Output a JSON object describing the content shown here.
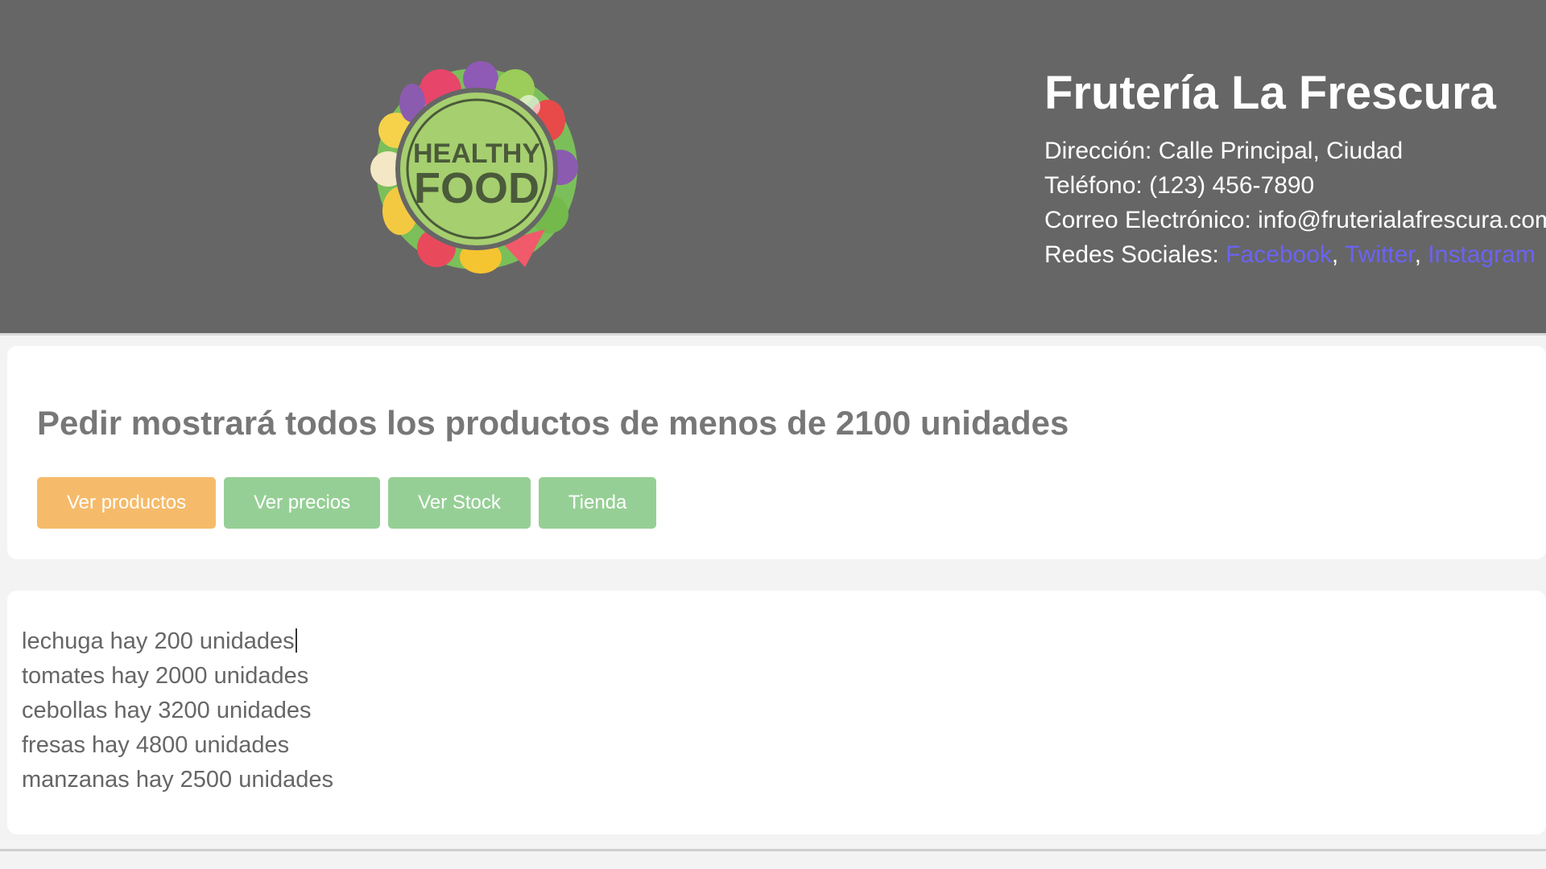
{
  "header": {
    "logo": {
      "line1": "HEALTHY",
      "line2": "FOOD",
      "ring_color": "#a6cf6f",
      "text_color": "#4a5a3a"
    },
    "title": "Frutería La Frescura",
    "address": "Dirección: Calle Principal, Ciudad",
    "phone": "Teléfono: (123) 456-7890",
    "email": "Correo Electrónico: info@fruterialafrescura.com",
    "social_label": "Redes Sociales:",
    "social_links": {
      "facebook": "Facebook",
      "twitter": "Twitter",
      "instagram": "Instagram"
    },
    "sep": ","
  },
  "actions": {
    "instruction": "Pedir mostrará todos los productos de menos de 2100 unidades",
    "buttons": {
      "ver_productos": "Ver productos",
      "ver_precios": "Ver precios",
      "ver_stock": "Ver Stock",
      "tienda": "Tienda"
    }
  },
  "products": [
    "lechuga hay 200 unidades",
    "tomates hay 2000 unidades",
    "cebollas hay 3200 unidades",
    "fresas hay 4800 unidades",
    "manzanas hay 2500 unidades"
  ],
  "colors": {
    "header_bg": "#666666",
    "link": "#6b63f5",
    "btn_orange": "#f6bb6a",
    "btn_green": "#96cf96"
  }
}
